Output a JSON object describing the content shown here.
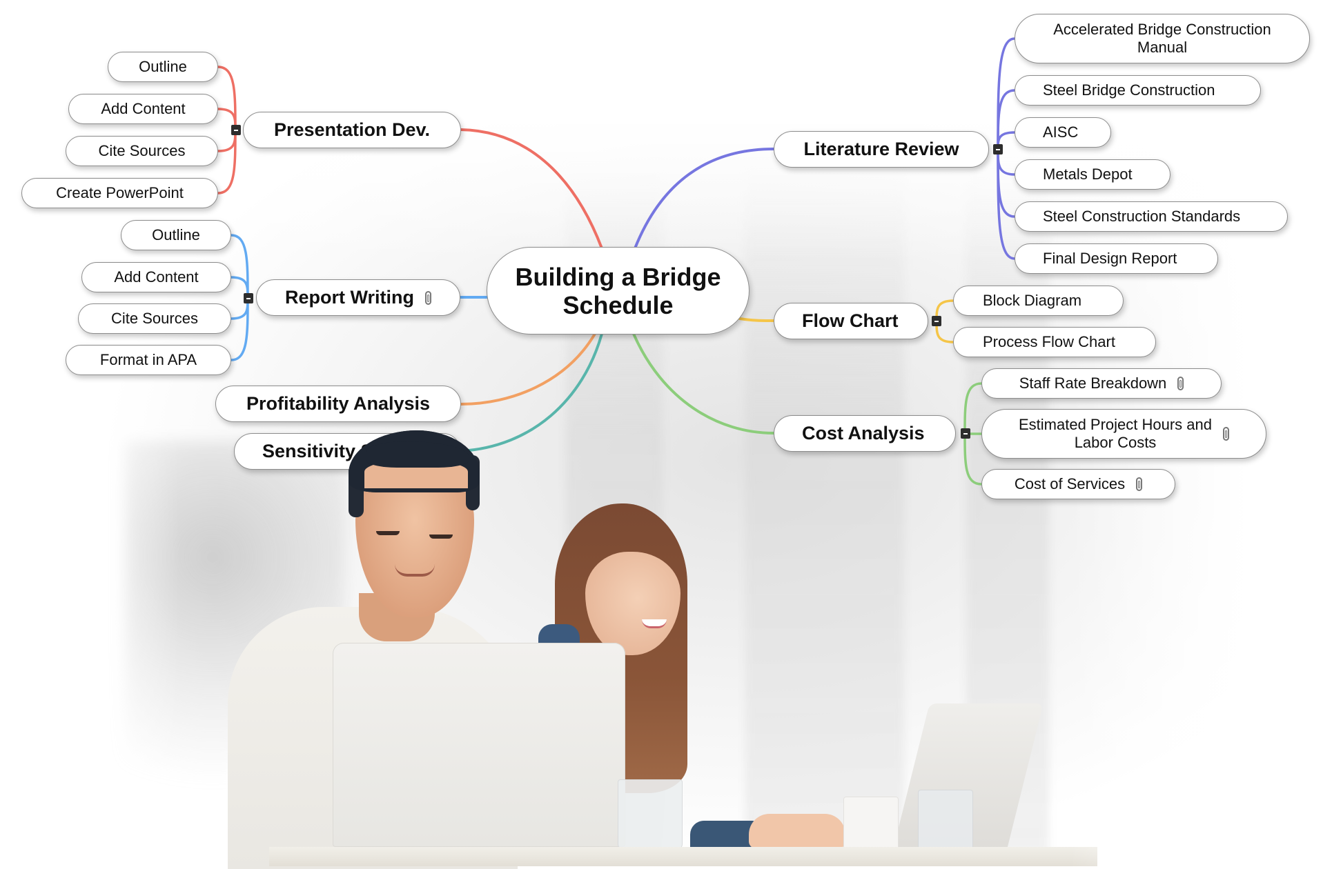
{
  "mindmap": {
    "root": {
      "label": "Building a Bridge\nSchedule"
    },
    "colors": {
      "presentation": "#ee6f64",
      "report": "#62aaf2",
      "profitability": "#f2a062",
      "sensitivity": "#58b5ab",
      "literature": "#7676e0",
      "flowchart": "#f5c548",
      "cost": "#8ccd7b"
    },
    "branches": {
      "presentation": {
        "label": "Presentation Dev.",
        "children": [
          "Outline",
          "Add Content",
          "Cite Sources",
          "Create PowerPoint"
        ]
      },
      "report": {
        "label": "Report Writing",
        "has_attachment": true,
        "children": [
          "Outline",
          "Add Content",
          "Cite Sources",
          "Format in APA"
        ]
      },
      "profitability": {
        "label": "Profitability Analysis"
      },
      "sensitivity": {
        "label": "Sensitivity S"
      },
      "literature": {
        "label": "Literature Review",
        "children": [
          "Accelerated Bridge Construction\nManual",
          "Steel Bridge Construction",
          "AISC",
          "Metals Depot",
          "Steel Construction Standards",
          "Final Design Report"
        ]
      },
      "flowchart": {
        "label": "Flow Chart",
        "children": [
          "Block Diagram",
          "Process Flow Chart"
        ]
      },
      "cost": {
        "label": "Cost Analysis",
        "children": [
          {
            "label": "Staff Rate Breakdown",
            "has_attachment": true
          },
          {
            "label": "Estimated Project Hours and\nLabor Costs",
            "has_attachment": true
          },
          {
            "label": "Cost of Services",
            "has_attachment": true
          }
        ]
      }
    },
    "icons": {
      "collapse": "minus-square-icon",
      "attachment": "paperclip-icon"
    }
  },
  "photo": {
    "description": "Two people smiling while working on laptops at a white table"
  }
}
